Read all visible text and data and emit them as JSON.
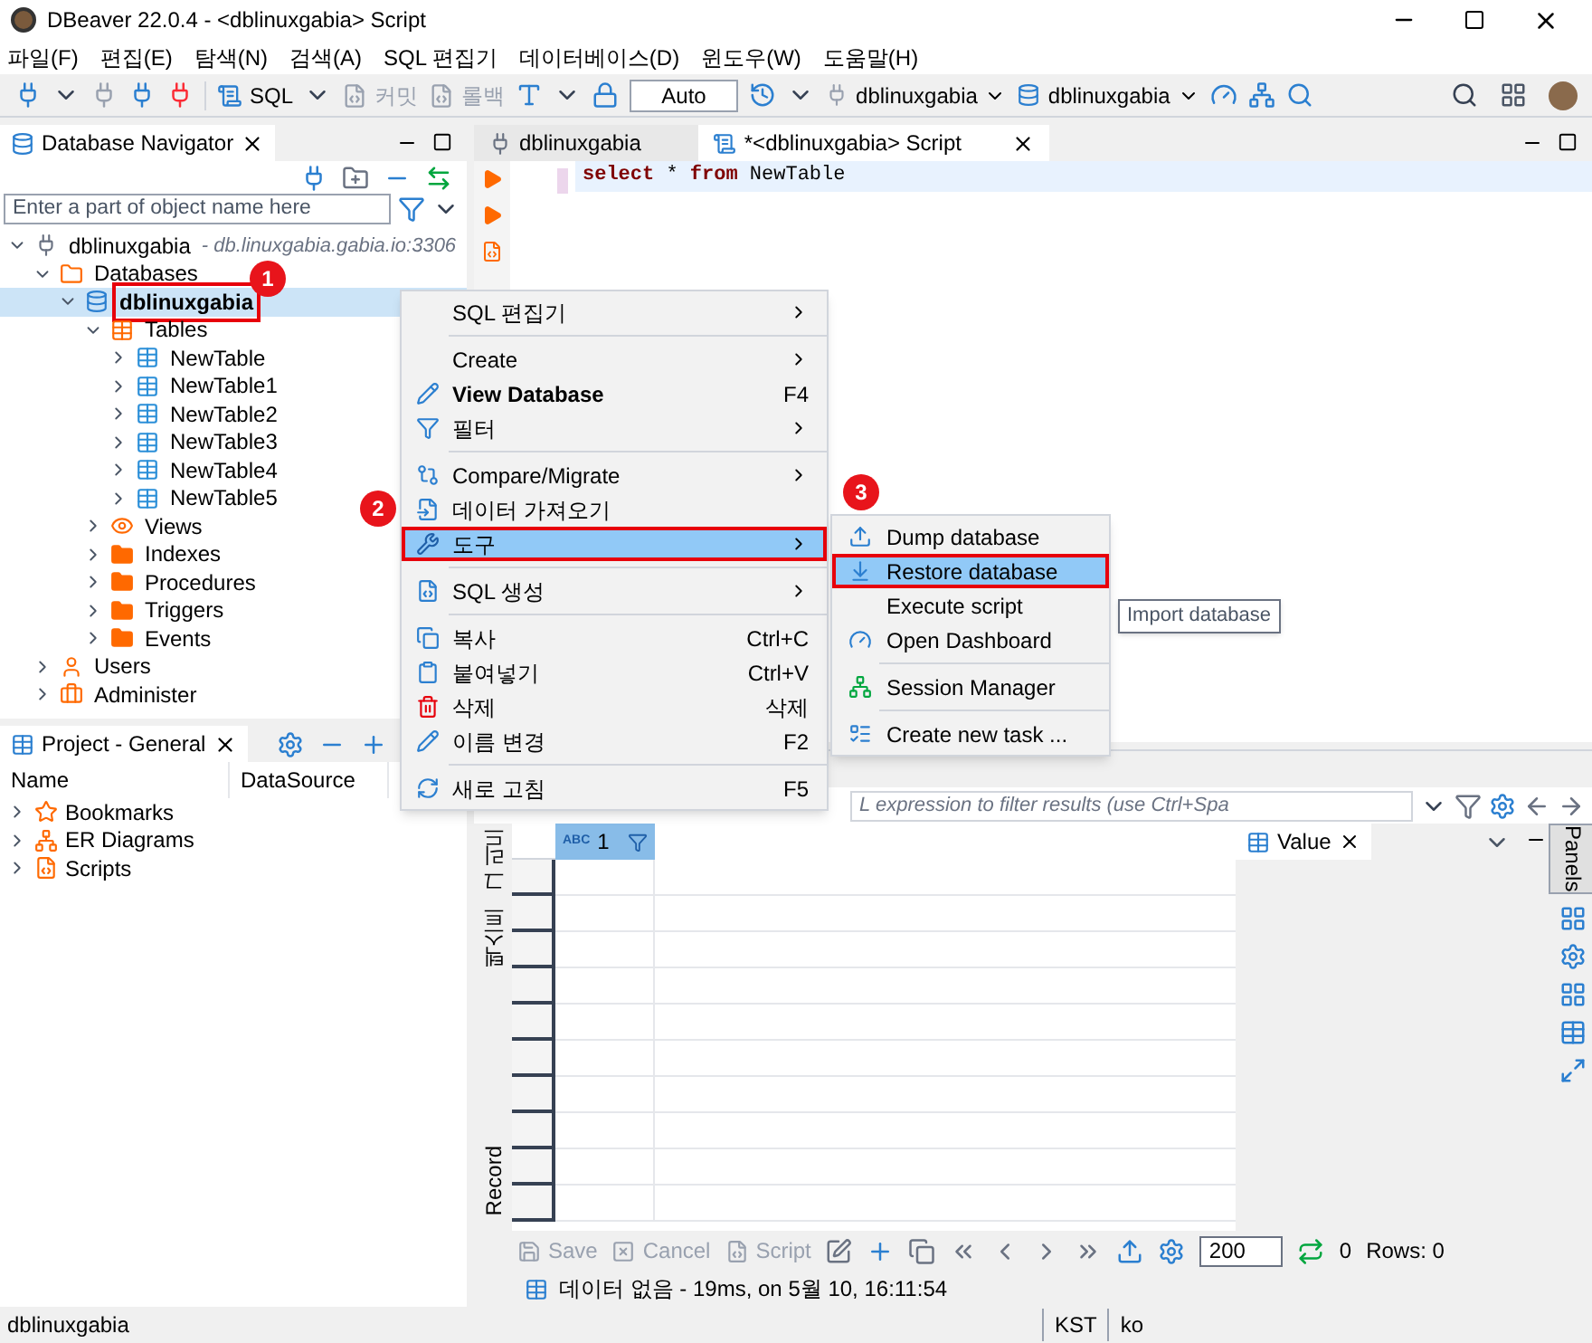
{
  "window": {
    "title": "DBeaver 22.0.4 - <dblinuxgabia> Script"
  },
  "menu_bar": [
    "파일(F)",
    "편집(E)",
    "탐색(N)",
    "검색(A)",
    "SQL 편집기",
    "데이터베이스(D)",
    "윈도우(W)",
    "도움말(H)"
  ],
  "toolbar": {
    "sql": "SQL",
    "commit": "커밋",
    "rollback": "롤백",
    "transaction_mode": "Auto",
    "connection": "dblinuxgabia",
    "database": "dblinuxgabia"
  },
  "navigator": {
    "title": "Database Navigator",
    "search_placeholder": "Enter a part of object name here",
    "tree": [
      {
        "label": "dblinuxgabia",
        "detail": "- db.linuxgabia.gabia.io:3306",
        "kind": "connection",
        "expanded": true,
        "selected": false,
        "children": [
          {
            "label": "Databases",
            "kind": "databases",
            "expanded": true,
            "selected": false,
            "children": [
              {
                "label": "dblinuxgabia",
                "kind": "database",
                "expanded": true,
                "selected": true,
                "children": [
                  {
                    "label": "Tables",
                    "kind": "tables",
                    "expanded": true,
                    "selected": false,
                    "children": [
                      {
                        "label": "NewTable",
                        "kind": "table",
                        "expanded": false,
                        "selected": false
                      },
                      {
                        "label": "NewTable1",
                        "kind": "table",
                        "expanded": false,
                        "selected": false
                      },
                      {
                        "label": "NewTable2",
                        "kind": "table",
                        "expanded": false,
                        "selected": false
                      },
                      {
                        "label": "NewTable3",
                        "kind": "table",
                        "expanded": false,
                        "selected": false
                      },
                      {
                        "label": "NewTable4",
                        "kind": "table",
                        "expanded": false,
                        "selected": false
                      },
                      {
                        "label": "NewTable5",
                        "kind": "table",
                        "expanded": false,
                        "selected": false
                      }
                    ]
                  },
                  {
                    "label": "Views",
                    "kind": "views",
                    "expanded": false,
                    "selected": false
                  },
                  {
                    "label": "Indexes",
                    "kind": "folder",
                    "expanded": false,
                    "selected": false
                  },
                  {
                    "label": "Procedures",
                    "kind": "folder",
                    "expanded": false,
                    "selected": false
                  },
                  {
                    "label": "Triggers",
                    "kind": "folder",
                    "expanded": false,
                    "selected": false
                  },
                  {
                    "label": "Events",
                    "kind": "folder",
                    "expanded": false,
                    "selected": false
                  }
                ]
              }
            ]
          },
          {
            "label": "Users",
            "kind": "users",
            "expanded": false,
            "selected": false
          },
          {
            "label": "Administer",
            "kind": "administer",
            "expanded": false,
            "selected": false
          }
        ]
      }
    ]
  },
  "project": {
    "title": "Project - General",
    "columns": [
      "Name",
      "DataSource"
    ],
    "items": [
      {
        "label": "Bookmarks",
        "kind": "bookmarks"
      },
      {
        "label": "ER Diagrams",
        "kind": "diagrams"
      },
      {
        "label": "Scripts",
        "kind": "scripts"
      }
    ]
  },
  "editor": {
    "tabs": [
      {
        "label": "dblinuxgabia",
        "selected": false,
        "kind": "connection"
      },
      {
        "label": "*<dblinuxgabia> Script",
        "selected": true,
        "kind": "script"
      }
    ],
    "code": [
      {
        "text": "select",
        "kind": "keyword"
      },
      {
        "text": " * ",
        "kind": "plain"
      },
      {
        "text": "from",
        "kind": "keyword"
      },
      {
        "text": " NewTable",
        "kind": "plain"
      }
    ]
  },
  "results": {
    "filter_placeholder": "L expression to filter results (use Ctrl+Spa",
    "column_type": "ABC",
    "column": "1",
    "side_tabs": [
      "그리드",
      "텍스트",
      "Record"
    ],
    "value_tab": "Value",
    "panels": "Panels",
    "actions": [
      "Save",
      "Cancel",
      "Script"
    ],
    "fetch_size": "200",
    "count": "0",
    "rows": "Rows: 0",
    "status": "데이터 없음 - 19ms, on 5월 10, 16:11:54"
  },
  "context_menu": {
    "items": [
      {
        "kind": "item",
        "label": "SQL 편집기",
        "submenu": true,
        "bold": false,
        "selected": false
      },
      {
        "kind": "separator"
      },
      {
        "kind": "item",
        "label": "Create",
        "submenu": true,
        "bold": false,
        "selected": false
      },
      {
        "kind": "item",
        "label": "View Database",
        "shortcut": "F4",
        "submenu": false,
        "bold": true,
        "selected": false
      },
      {
        "kind": "item",
        "label": "필터",
        "submenu": true,
        "bold": false,
        "selected": false
      },
      {
        "kind": "separator"
      },
      {
        "kind": "item",
        "label": "Compare/Migrate",
        "submenu": true,
        "bold": false,
        "selected": false
      },
      {
        "kind": "item",
        "label": "데이터 가져오기",
        "submenu": false,
        "bold": false,
        "selected": false
      },
      {
        "kind": "item",
        "label": "도구",
        "submenu": true,
        "bold": false,
        "selected": true
      },
      {
        "kind": "separator"
      },
      {
        "kind": "item",
        "label": "SQL 생성",
        "submenu": true,
        "bold": false,
        "selected": false
      },
      {
        "kind": "separator"
      },
      {
        "kind": "item",
        "label": "복사",
        "shortcut": "Ctrl+C",
        "submenu": false,
        "bold": false,
        "selected": false
      },
      {
        "kind": "item",
        "label": "붙여넣기",
        "shortcut": "Ctrl+V",
        "submenu": false,
        "bold": false,
        "selected": false
      },
      {
        "kind": "item",
        "label": "삭제",
        "shortcut": "삭제",
        "submenu": false,
        "bold": false,
        "selected": false
      },
      {
        "kind": "item",
        "label": "이름 변경",
        "shortcut": "F2",
        "submenu": false,
        "bold": false,
        "selected": false
      },
      {
        "kind": "separator"
      },
      {
        "kind": "item",
        "label": "새로 고침",
        "shortcut": "F5",
        "submenu": false,
        "bold": false,
        "selected": false
      }
    ]
  },
  "submenu": {
    "items": [
      {
        "kind": "item",
        "label": "Dump database",
        "selected": false
      },
      {
        "kind": "item",
        "label": "Restore database",
        "selected": true
      },
      {
        "kind": "item",
        "label": "Execute script",
        "selected": false
      },
      {
        "kind": "item",
        "label": "Open Dashboard",
        "selected": false
      },
      {
        "kind": "separator"
      },
      {
        "kind": "item",
        "label": "Session Manager",
        "selected": false
      },
      {
        "kind": "separator"
      },
      {
        "kind": "item",
        "label": "Create new task ...",
        "selected": false
      }
    ]
  },
  "tooltip": "Import database",
  "callouts": [
    "1",
    "2",
    "3"
  ],
  "status_bar": [
    "dblinuxgabia",
    "KST",
    "ko"
  ]
}
